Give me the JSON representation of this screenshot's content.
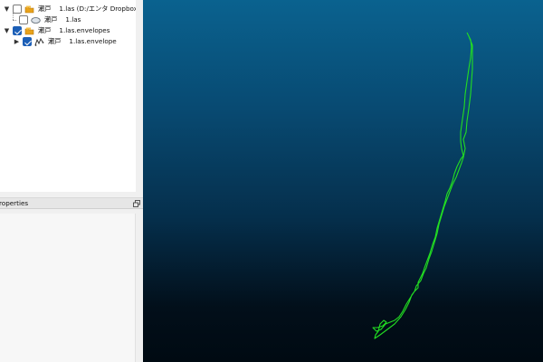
{
  "db_tree": {
    "items": [
      {
        "label": "瀬戸",
        "suffix": "1.las (D:/エンタ Dropbox/...",
        "checked": false,
        "expanded": true,
        "icon": "folder-icon"
      },
      {
        "label": "瀬戸",
        "suffix": "1.las",
        "checked": false,
        "icon": "cloud-icon"
      },
      {
        "label": "瀬戸",
        "suffix": "1.las.envelopes",
        "checked": true,
        "expanded": true,
        "icon": "folder-icon"
      },
      {
        "label": "瀬戸",
        "suffix": "1.las.envelope",
        "checked": true,
        "expanded": false,
        "icon": "polyline-icon"
      }
    ]
  },
  "properties": {
    "title": "roperties"
  },
  "view3d": {
    "background_top": "#0a628f",
    "background_bottom": "#000a12",
    "polyline_color": "#22dd22"
  }
}
